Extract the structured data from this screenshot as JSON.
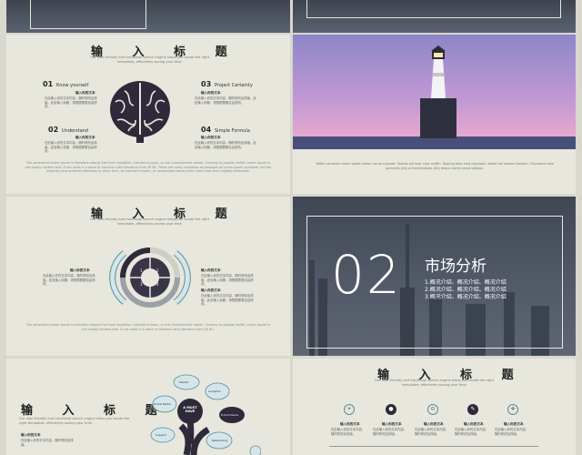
{
  "s1": {
    "title": "输 入 标 题",
    "subtitle": "Our user-friendly and functional search engine helps you locate the right templates, effectively saving your time",
    "items": [
      {
        "num": "01",
        "label": "Know yourself",
        "head": "输入你的文本",
        "body": "在此输入你的文本内容，随时修改及排版。此处输入标题，请根据需要自由修改。"
      },
      {
        "num": "02",
        "label": "Understand",
        "head": "输入你的文本",
        "body": "在此输入你的文本内容，随时修改及排版。此处输入标题，请根据需要自由修改。"
      },
      {
        "num": "03",
        "label": "Project Certainty",
        "head": "输入你的文本",
        "body": "在此输入你的文本内容，随时修改及排版。此处输入标题，请根据需要自由修改。"
      },
      {
        "num": "04",
        "label": "Simple Formula",
        "head": "输入你的文本",
        "body": "在此输入你的文本内容，随时修改及排版。此处输入标题，请根据需要自由修改。"
      }
    ],
    "footer": "The generated Lorem Ipsum is therefore always free from repetition, injected humour, or non-characteristic words. Contrary to popular belief, Lorem Ipsum is not simply random text. It has roots in a piece of classical Latin literature from 45 BC. There are many variations of passages of Lorem Ipsum available, but the majority have suffered alteration in some form, by injected humour, or randomised words which don't look even slightly believable."
  },
  "s2": {
    "caption": "Toffee caramels candy sweet cotton candy cupcake. Tootsie roll bear claw muffin. Topping bear claw marzipan. Sweet roll dessert bonbon. Chocolate cake gummies jelly-o marshmallow. Jelly beans candy canes lollipop."
  },
  "s3": {
    "title": "输 入 标 题",
    "subtitle": "Our user-friendly and functional search engine helps you locate the right templates, effectively saving your time",
    "left_head": "输入你的文本",
    "left_body": "在此输入你的文本内容，随时修改及排版。此处输入标题，请根据需要自由修改。",
    "right_head": "输入你的文本",
    "right_body": "在此输入你的文本内容，随时修改及排版。此处输入标题，请根据需要自由修改。",
    "right_head2": "输入你的文本",
    "right_body2": "在此输入你的文本内容，随时修改及排版。此处输入标题，请根据需要自由修改。",
    "nums": [
      "1",
      "2",
      "3",
      "4"
    ],
    "footer": "The generated Lorem Ipsum is therefore always free from repetition, injected humour, or non-characteristic words. Contrary to popular belief, Lorem Ipsum is not simply random text. It has roots in a piece of classical Latin literature from 45 BC."
  },
  "s4": {
    "number": "02",
    "heading": "市场分析",
    "bullets": [
      "1.概况介绍、概况介绍、概况介绍",
      "2.概况介绍、概况介绍、概况介绍",
      "3.概况介绍、概况介绍、概况介绍"
    ]
  },
  "s5": {
    "title": "输 入 标 题",
    "subtitle": "Our user-friendly and functional search engine helps you locate the right templates, effectively saving your time",
    "head": "输入你的文本",
    "body": "在此输入你的文本内容，随时修改及排版。",
    "tree_center": "A MUST HAVE",
    "bubbles": [
      "Social Media",
      "Analytics",
      "E-Commerce",
      "Support",
      "Networking",
      "Market"
    ]
  },
  "s6": {
    "title": "输 入 标 题",
    "subtitle": "Our user-friendly and functional search engine helps you locate the right templates, effectively saving your time",
    "cols": [
      {
        "head": "输入你的文本",
        "body": "在此输入你的文本内容，随时修改及排版。"
      },
      {
        "head": "输入你的文本",
        "body": "在此输入你的文本内容，随时修改及排版。"
      },
      {
        "head": "输入你的文本",
        "body": "在此输入你的文本内容，随时修改及排版。"
      },
      {
        "head": "输入你的文本",
        "body": "在此输入你的文本内容，随时修改及排版。"
      },
      {
        "head": "输入你的文本",
        "body": "在此输入你的文本内容，随时修改及排版。"
      }
    ]
  },
  "colors": {
    "accent": "#2e2a3a",
    "light_blue": "#d4e6ea",
    "blue_stroke": "#5d8c99"
  }
}
